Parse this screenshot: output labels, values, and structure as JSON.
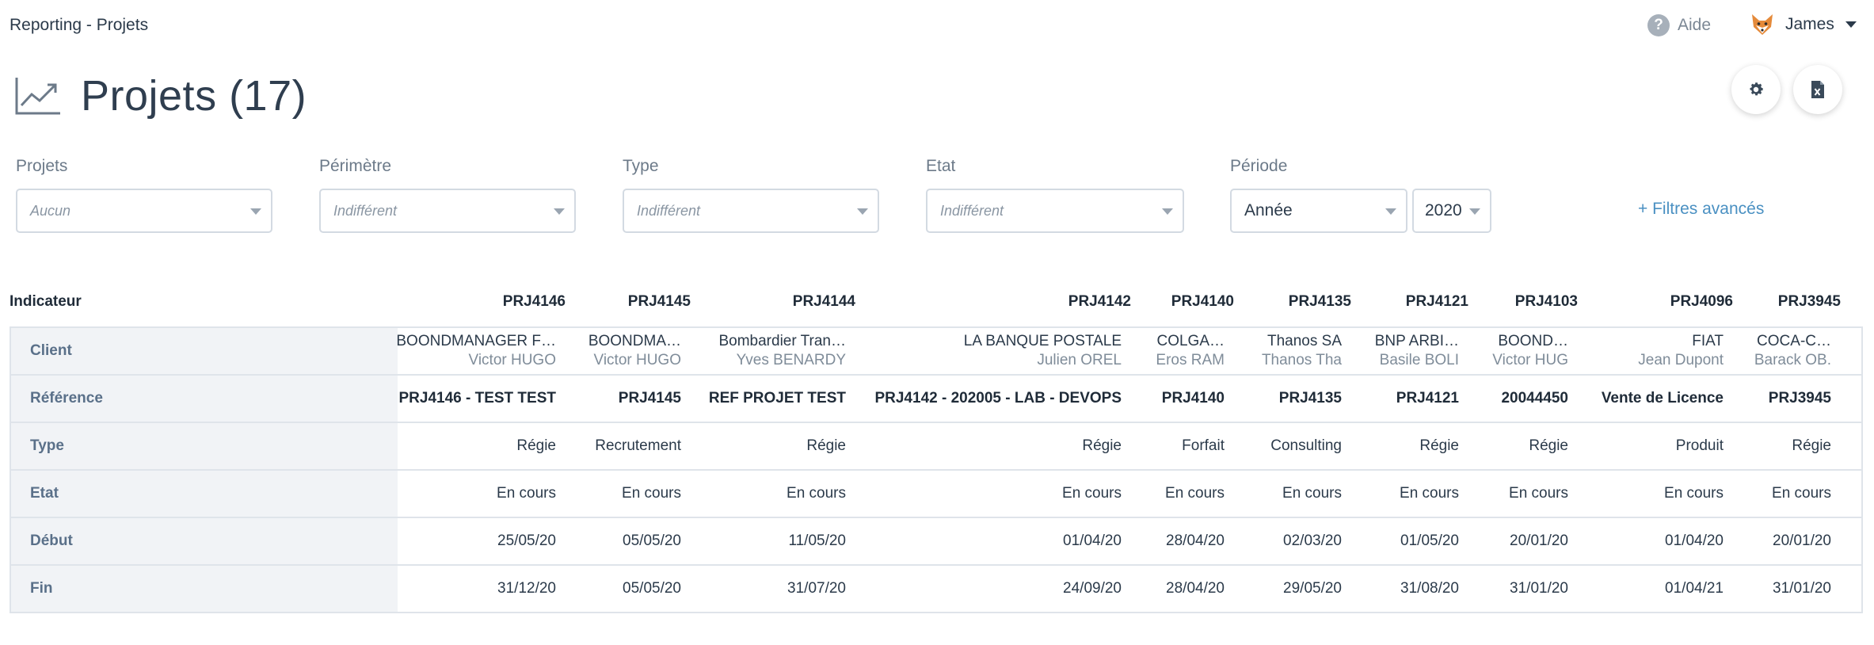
{
  "app": {
    "title": "Reporting - Projets",
    "help_label": "Aide",
    "user_name": "James"
  },
  "header": {
    "title": "Projets (17)",
    "icon": "trending-up-icon"
  },
  "actions": {
    "settings_icon": "gear-icon",
    "export_icon": "excel-file-icon"
  },
  "filters": {
    "projets": {
      "label": "Projets",
      "value": "Aucun"
    },
    "perimetre": {
      "label": "Périmètre",
      "value": "Indifférent"
    },
    "type": {
      "label": "Type",
      "value": "Indifférent"
    },
    "etat": {
      "label": "Etat",
      "value": "Indifférent"
    },
    "periode": {
      "label": "Période",
      "value": "Année",
      "year": "2020"
    },
    "advanced_label": "+ Filtres avancés"
  },
  "table": {
    "indicator_header": "Indicateur",
    "row_labels": [
      "Client",
      "Référence",
      "Type",
      "Etat",
      "Début",
      "Fin"
    ],
    "columns": [
      {
        "id": "PRJ4146",
        "client": "BOONDMANAGER F…",
        "manager": "Victor HUGO",
        "reference": "PRJ4146 - TEST TEST",
        "type": "Régie",
        "etat": "En cours",
        "debut": "25/05/20",
        "fin": "31/12/20"
      },
      {
        "id": "PRJ4145",
        "client": "BOONDMA…",
        "manager": "Victor HUGO",
        "reference": "PRJ4145",
        "type": "Recrutement",
        "etat": "En cours",
        "debut": "05/05/20",
        "fin": "05/05/20"
      },
      {
        "id": "PRJ4144",
        "client": "Bombardier Tran…",
        "manager": "Yves BENARDY",
        "reference": "REF PROJET TEST",
        "type": "Régie",
        "etat": "En cours",
        "debut": "11/05/20",
        "fin": "31/07/20"
      },
      {
        "id": "PRJ4142",
        "client": "LA BANQUE POSTALE",
        "manager": "Julien OREL",
        "reference": "PRJ4142 - 202005 - LAB - DEVOPS",
        "type": "Régie",
        "etat": "En cours",
        "debut": "01/04/20",
        "fin": "24/09/20"
      },
      {
        "id": "PRJ4140",
        "client": "COLGA…",
        "manager": "Eros RAM",
        "reference": "PRJ4140",
        "type": "Forfait",
        "etat": "En cours",
        "debut": "28/04/20",
        "fin": "28/04/20"
      },
      {
        "id": "PRJ4135",
        "client": "Thanos SA",
        "manager": "Thanos Tha",
        "reference": "PRJ4135",
        "type": "Consulting",
        "etat": "En cours",
        "debut": "02/03/20",
        "fin": "29/05/20"
      },
      {
        "id": "PRJ4121",
        "client": "BNP ARBI…",
        "manager": "Basile BOLI",
        "reference": "PRJ4121",
        "type": "Régie",
        "etat": "En cours",
        "debut": "01/05/20",
        "fin": "31/08/20"
      },
      {
        "id": "PRJ4103",
        "client": "BOOND…",
        "manager": "Victor HUG",
        "reference": "20044450",
        "type": "Régie",
        "etat": "En cours",
        "debut": "20/01/20",
        "fin": "31/01/20"
      },
      {
        "id": "PRJ4096",
        "client": "FIAT",
        "manager": "Jean Dupont",
        "reference": "Vente de Licence",
        "type": "Produit",
        "etat": "En cours",
        "debut": "01/04/20",
        "fin": "01/04/21"
      },
      {
        "id": "PRJ3945",
        "client": "COCA-C…",
        "manager": "Barack OB.",
        "reference": "PRJ3945",
        "type": "Régie",
        "etat": "En cours",
        "debut": "20/01/20",
        "fin": "31/01/20"
      }
    ]
  }
}
